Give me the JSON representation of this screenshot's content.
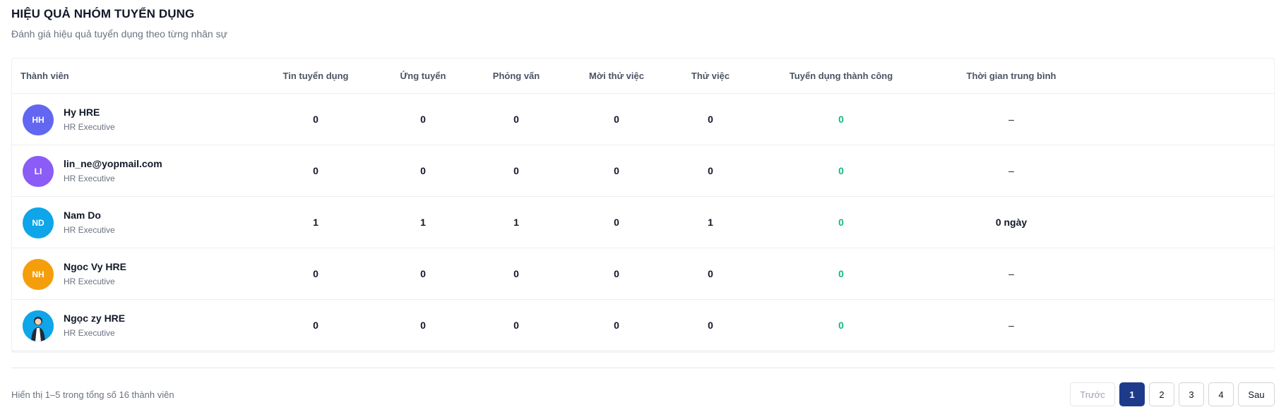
{
  "header": {
    "title": "HIỆU QUẢ NHÓM TUYỂN DỤNG",
    "subtitle": "Đánh giá hiệu quả tuyển dụng theo từng nhân sự"
  },
  "table": {
    "columns": {
      "member": "Thành viên",
      "jobs": "Tin tuyển dụng",
      "applied": "Ứng tuyển",
      "interview": "Phỏng vấn",
      "invite_trial": "Mời thử việc",
      "trial": "Thử việc",
      "hired": "Tuyển dụng thành công",
      "avg_time": "Thời gian trung bình"
    },
    "rows": [
      {
        "initials": "HH",
        "name": "Hy HRE",
        "role": "HR Executive",
        "jobs": "0",
        "applied": "0",
        "interview": "0",
        "invite_trial": "0",
        "trial": "0",
        "hired": "0",
        "avg_time": "–"
      },
      {
        "initials": "LI",
        "name": "lin_ne@yopmail.com",
        "role": "HR Executive",
        "jobs": "0",
        "applied": "0",
        "interview": "0",
        "invite_trial": "0",
        "trial": "0",
        "hired": "0",
        "avg_time": "–"
      },
      {
        "initials": "ND",
        "name": "Nam Do",
        "role": "HR Executive",
        "jobs": "1",
        "applied": "1",
        "interview": "1",
        "invite_trial": "0",
        "trial": "1",
        "hired": "0",
        "avg_time": "0 ngày"
      },
      {
        "initials": "NH",
        "name": "Ngoc Vy HRE",
        "role": "HR Executive",
        "jobs": "0",
        "applied": "0",
        "interview": "0",
        "invite_trial": "0",
        "trial": "0",
        "hired": "0",
        "avg_time": "–"
      },
      {
        "initials": "",
        "name": "Ngọc zy HRE",
        "role": "HR Executive",
        "jobs": "0",
        "applied": "0",
        "interview": "0",
        "invite_trial": "0",
        "trial": "0",
        "hired": "0",
        "avg_time": "–"
      }
    ]
  },
  "footer": {
    "info": "Hiển thị 1–5 trong tổng số 16 thành viên"
  },
  "pagination": {
    "prev": "Trước",
    "pages": [
      "1",
      "2",
      "3",
      "4"
    ],
    "next": "Sau",
    "current": "1"
  },
  "colors": {
    "avatar_hh": "#6366f1",
    "avatar_li": "#8b5cf6",
    "avatar_nd": "#0ea5e9",
    "avatar_nh": "#f59e0b",
    "success": "#10b981",
    "active_page": "#1e3a8a"
  }
}
